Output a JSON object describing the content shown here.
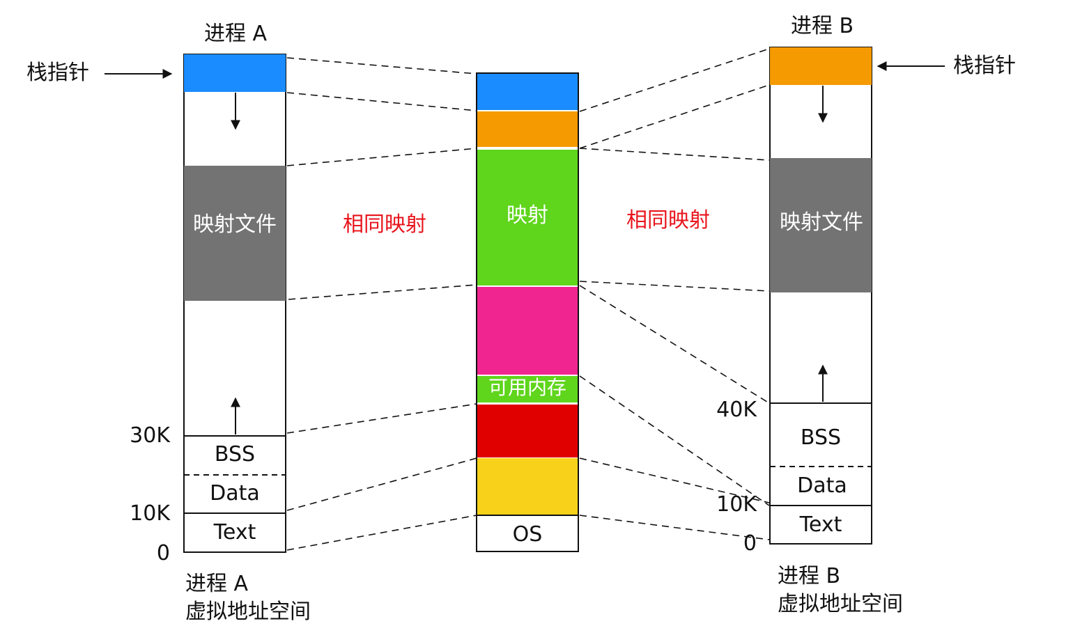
{
  "process_a": {
    "title": "进程 A",
    "caption_line1": "进程 A",
    "caption_line2": "虚拟地址空间",
    "stack_pointer": "栈指针",
    "mapped_file": "映射文件",
    "bss": "BSS",
    "data": "Data",
    "text": "Text",
    "addr_30k": "30K",
    "addr_10k": "10K",
    "addr_0": "0"
  },
  "process_b": {
    "title": "进程 B",
    "caption_line1": "进程 B",
    "caption_line2": "虚拟地址空间",
    "stack_pointer": "栈指针",
    "mapped_file": "映射文件",
    "bss": "BSS",
    "data": "Data",
    "text": "Text",
    "addr_40k": "40K",
    "addr_10k": "10K",
    "addr_0": "0"
  },
  "physical_memory": {
    "mapping": "映射",
    "free_memory": "可用内存",
    "os": "OS"
  },
  "same_mapping_left": "相同映射",
  "same_mapping_right": "相同映射",
  "colors": {
    "stack_a": "#1a8cff",
    "stack_b": "#f59a00",
    "mapped_file": "#737373",
    "mapping_green": "#5fd51c",
    "pink": "#f0258f",
    "red": "#e00000",
    "yellow": "#f8d21a",
    "label_red": "#e8141c"
  }
}
